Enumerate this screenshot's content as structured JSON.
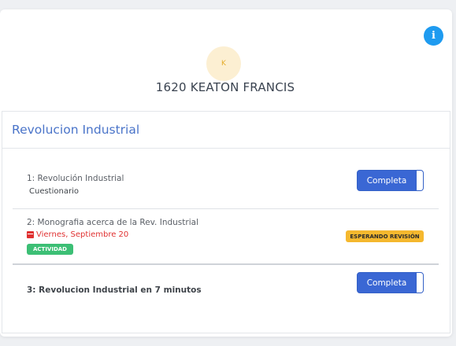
{
  "header": {
    "avatar_initial": "K",
    "student_name": "1620 KEATON FRANCIS",
    "info_label": "i"
  },
  "course": {
    "title": "Revolucion Industrial",
    "items": [
      {
        "title": "1: Revolución Industrial",
        "subtitle": "Cuestionario",
        "action_label": "Completa"
      },
      {
        "title": "2: Monografia acerca de la Rev. Industrial",
        "date": "Viernes, Septiembre 20",
        "tag": "ACTIVIDAD",
        "status": "ESPERANDO REVISIÓN"
      },
      {
        "title": "3: Revolucion Industrial en 7 minutos",
        "action_label": "Completa"
      }
    ]
  },
  "colors": {
    "accent": "#3a67d4",
    "info": "#1e9bf0",
    "date": "#e03131",
    "tag": "#3cbf75",
    "pending": "#f5b82e"
  }
}
